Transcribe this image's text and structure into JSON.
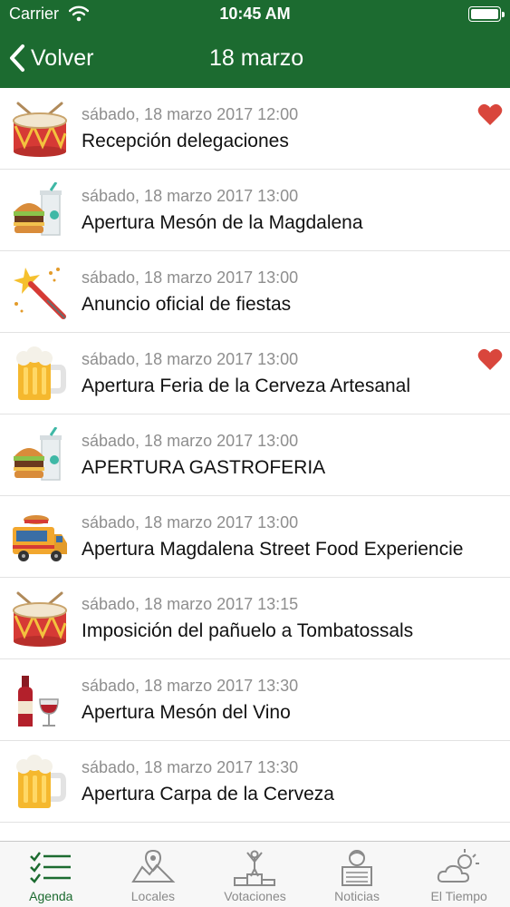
{
  "status_bar": {
    "carrier": "Carrier",
    "time": "10:45 AM"
  },
  "nav": {
    "back_label": "Volver",
    "title": "18 marzo"
  },
  "events": [
    {
      "icon": "drum-icon",
      "date": "sábado, 18 marzo 2017 12:00",
      "title": "Recepción delegaciones",
      "favorite": true
    },
    {
      "icon": "burger-drink-icon",
      "date": "sábado, 18 marzo 2017 13:00",
      "title": "Apertura Mesón de la Magdalena",
      "favorite": false
    },
    {
      "icon": "firecracker-icon",
      "date": "sábado, 18 marzo 2017 13:00",
      "title": "Anuncio oficial de fiestas",
      "favorite": false
    },
    {
      "icon": "beer-mug-icon",
      "date": "sábado, 18 marzo 2017 13:00",
      "title": "Apertura Feria de la Cerveza Artesanal",
      "favorite": true
    },
    {
      "icon": "burger-drink-icon",
      "date": "sábado, 18 marzo 2017 13:00",
      "title": "APERTURA GASTROFERIA",
      "favorite": false
    },
    {
      "icon": "food-truck-icon",
      "date": "sábado, 18 marzo 2017 13:00",
      "title": "Apertura Magdalena Street Food Experiencie",
      "favorite": false
    },
    {
      "icon": "drum-icon",
      "date": "sábado, 18 marzo 2017 13:15",
      "title": "Imposición del pañuelo a Tombatossals",
      "favorite": false
    },
    {
      "icon": "wine-icon",
      "date": "sábado, 18 marzo 2017 13:30",
      "title": "Apertura Mesón del Vino",
      "favorite": false
    },
    {
      "icon": "beer-mug-icon",
      "date": "sábado, 18 marzo 2017 13:30",
      "title": "Apertura Carpa de la Cerveza",
      "favorite": false
    }
  ],
  "tabs": [
    {
      "label": "Agenda",
      "icon": "checklist-icon",
      "active": true
    },
    {
      "label": "Locales",
      "icon": "map-pin-icon",
      "active": false
    },
    {
      "label": "Votaciones",
      "icon": "podium-icon",
      "active": false
    },
    {
      "label": "Noticias",
      "icon": "newspaper-reader-icon",
      "active": false
    },
    {
      "label": "El Tiempo",
      "icon": "weather-icon",
      "active": false
    }
  ],
  "colors": {
    "header": "#1c6b30",
    "heart": "#d9463c",
    "active_tab": "#1c6b30",
    "date_text": "#8e8e8e"
  }
}
